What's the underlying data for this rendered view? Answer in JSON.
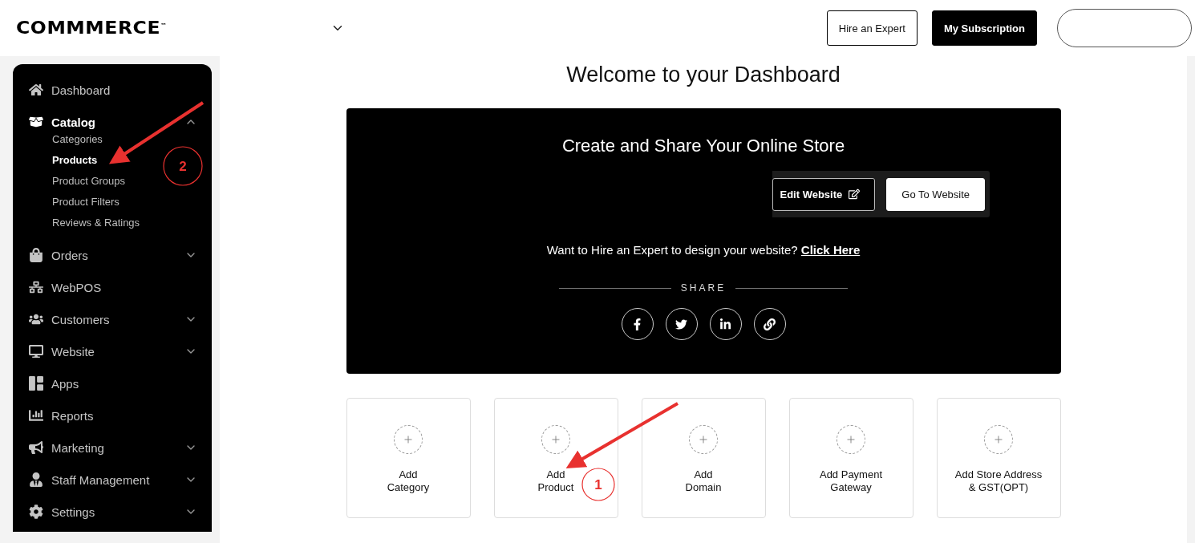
{
  "header": {
    "logo": "COMMMERCE$^{™}$",
    "buttons": [
      {
        "label": "Hire an Expert",
        "kind": "outline"
      },
      {
        "label": "My Subscription",
        "kind": "solid"
      }
    ]
  },
  "sidebar": {
    "items": [
      {
        "label": "Dashboard",
        "kind": "link",
        "selected": false
      },
      {
        "label": "Catalog",
        "kind": "group",
        "selected": true,
        "expanded": true,
        "children": [
          {
            "label": "Categories",
            "selected": false
          },
          {
            "label": "Products",
            "selected": true
          },
          {
            "label": "Product Groups",
            "selected": false
          },
          {
            "label": "Product Filters",
            "selected": false
          },
          {
            "label": "Reviews & Ratings",
            "selected": false
          }
        ]
      },
      {
        "label": "Orders",
        "kind": "group",
        "selected": false,
        "expanded": false
      },
      {
        "label": "WebPOS",
        "kind": "link",
        "selected": false
      },
      {
        "label": "Customers",
        "kind": "group",
        "selected": false,
        "expanded": false
      },
      {
        "label": "Website",
        "kind": "group",
        "selected": false,
        "expanded": false
      },
      {
        "label": "Apps",
        "kind": "link",
        "selected": false
      },
      {
        "label": "Reports",
        "kind": "link",
        "selected": false
      },
      {
        "label": "Marketing",
        "kind": "group",
        "selected": false,
        "expanded": false
      },
      {
        "label": "Staff Management",
        "kind": "group",
        "selected": false,
        "expanded": false
      },
      {
        "label": "Settings",
        "kind": "group",
        "selected": false,
        "expanded": false
      }
    ]
  },
  "main": {
    "title": "Welcome to your Dashboard",
    "store_card": {
      "title": "Create and Share Your Online Store",
      "buttons": [
        {
          "label": "Edit Website",
          "kind": "outline"
        },
        {
          "label": "Go To Website",
          "kind": "solid"
        }
      ],
      "hire_text": "Want to Hire an Expert to design your website?",
      "hire_link": "Click Here",
      "share_label": "SHARE"
    },
    "tiles": [
      {
        "lines": [
          "Add",
          "Category"
        ]
      },
      {
        "lines": [
          "Add",
          "Product"
        ]
      },
      {
        "lines": [
          "Add",
          "Domain"
        ]
      },
      {
        "lines": [
          "Add Payment",
          "Gateway"
        ]
      },
      {
        "lines": [
          "Add Store Address",
          "& GST(OPT)"
        ]
      }
    ]
  },
  "annotations": [
    {
      "label": "2"
    },
    {
      "label": "1"
    }
  ]
}
